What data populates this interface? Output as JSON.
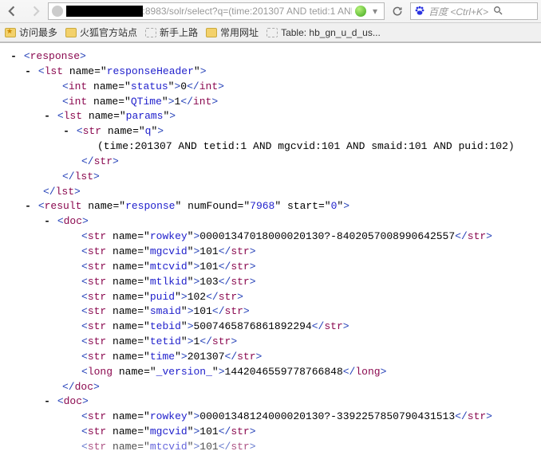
{
  "chrome": {
    "url_visible_suffix": ":8983/solr/select?q=(time:201307 AND tetid:1 AND",
    "search_placeholder": "百度 <Ctrl+K>",
    "bookmarks": [
      {
        "label": "访问最多",
        "icon": "folder-star"
      },
      {
        "label": "火狐官方站点",
        "icon": "folder"
      },
      {
        "label": "新手上路",
        "icon": "dashed"
      },
      {
        "label": "常用网址",
        "icon": "folder"
      },
      {
        "label": "Table: hb_gn_u_d_us...",
        "icon": "dashed"
      }
    ]
  },
  "xml": {
    "root": "response",
    "responseHeader": {
      "lst_name": "responseHeader",
      "status": {
        "tag": "int",
        "name": "status",
        "value": "0"
      },
      "qtime": {
        "tag": "int",
        "name": "QTime",
        "value": "1"
      },
      "params_lst_name": "params",
      "q_name": "q",
      "q_value": "(time:201307 AND tetid:1 AND mgcvid:101 AND smaid:101 AND puid:102)"
    },
    "result": {
      "name": "response",
      "numFound": "7968",
      "start": "0",
      "docs": [
        {
          "rowkey": "00001347018000020130?-8402057008990642557",
          "mgcvid": "101",
          "mtcvid": "101",
          "mtlkid": "103",
          "puid": "102",
          "smaid": "101",
          "tebid": "5007465876861892294",
          "tetid": "1",
          "time": "201307",
          "_version_": {
            "tag": "long",
            "value": "1442046559778766848"
          }
        },
        {
          "rowkey": "00001348124000020130?-3392257850790431513",
          "mgcvid": "101",
          "mtcvid_partial": "101"
        }
      ]
    }
  }
}
